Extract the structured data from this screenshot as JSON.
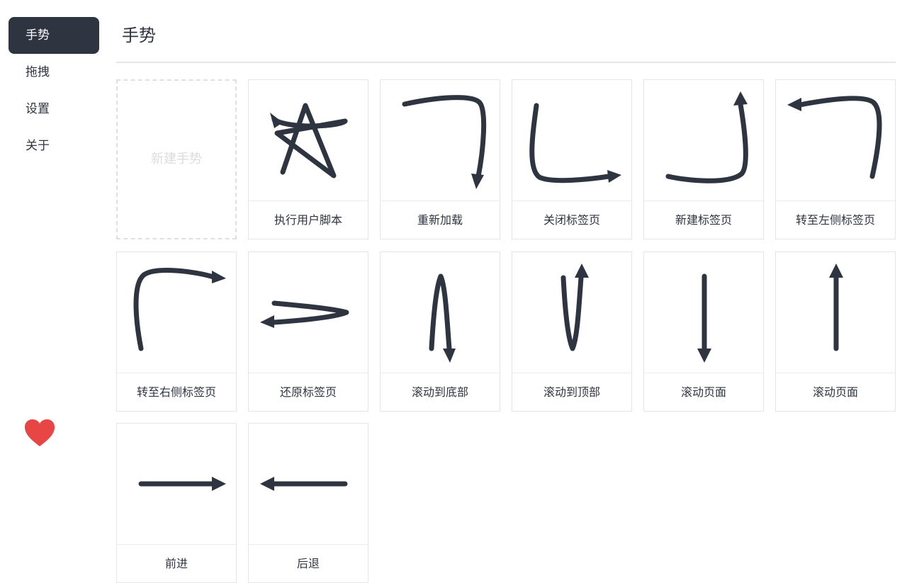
{
  "nav": {
    "items": [
      {
        "label": "手势",
        "active": true
      },
      {
        "label": "拖拽",
        "active": false
      },
      {
        "label": "设置",
        "active": false
      },
      {
        "label": "关于",
        "active": false
      }
    ],
    "heart_icon": "heart-icon",
    "heart_color": "#e84545"
  },
  "main": {
    "title": "手势",
    "new_gesture_label": "新建手势",
    "gestures": [
      {
        "label": "执行用户脚本",
        "icon": "star-gesture-icon"
      },
      {
        "label": "重新加载",
        "icon": "right-down-hook-gesture-icon"
      },
      {
        "label": "关闭标签页",
        "icon": "down-right-l-gesture-icon"
      },
      {
        "label": "新建标签页",
        "icon": "right-up-hook-gesture-icon"
      },
      {
        "label": "转至左侧标签页",
        "icon": "up-left-hook-gesture-icon"
      },
      {
        "label": "转至右侧标签页",
        "icon": "up-right-curve-gesture-icon"
      },
      {
        "label": "还原标签页",
        "icon": "right-left-zigzag-gesture-icon"
      },
      {
        "label": "滚动到底部",
        "icon": "up-down-gesture-icon"
      },
      {
        "label": "滚动到顶部",
        "icon": "down-up-gesture-icon"
      },
      {
        "label": "滚动页面",
        "icon": "down-arrow-gesture-icon"
      },
      {
        "label": "滚动页面",
        "icon": "up-arrow-gesture-icon"
      },
      {
        "label": "前进",
        "icon": "right-arrow-gesture-icon"
      },
      {
        "label": "后退",
        "icon": "left-arrow-gesture-icon"
      }
    ]
  },
  "colors": {
    "accent": "#2e3440",
    "border": "#e5e5e5",
    "dashed": "#e0e0e0"
  }
}
